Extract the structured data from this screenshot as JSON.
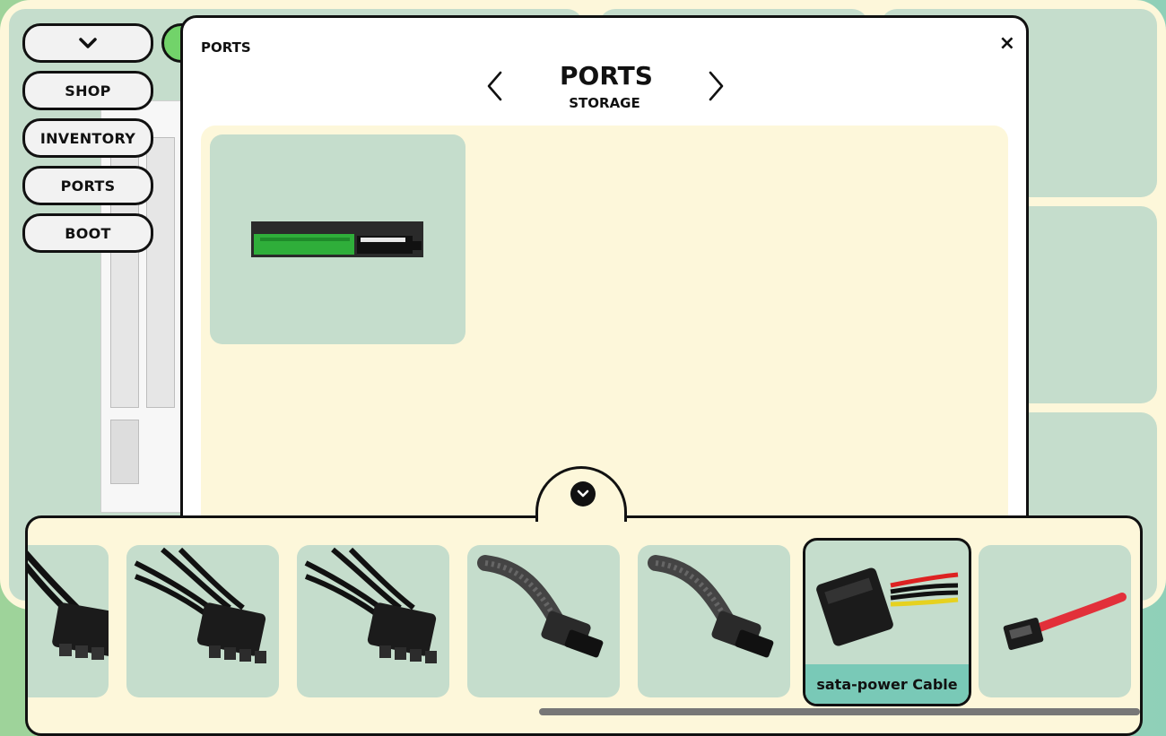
{
  "sidebar": {
    "toggle_icon": "chevron-down-icon",
    "items": [
      {
        "label": "SHOP"
      },
      {
        "label": "INVENTORY"
      },
      {
        "label": "PORTS"
      },
      {
        "label": "BOOT"
      }
    ]
  },
  "modal": {
    "small_title": "PORTS",
    "close_label": "×",
    "title": "PORTS",
    "subtitle": "STORAGE",
    "prev_icon": "chevron-left-icon",
    "next_icon": "chevron-right-icon",
    "ports": [
      {
        "icon": "sata-port-icon"
      }
    ]
  },
  "tray": {
    "collapse_icon": "chevron-down-icon",
    "items": [
      {
        "icon": "pcie-power-cable-icon",
        "selected": false
      },
      {
        "icon": "pcie-power-cable-icon",
        "selected": false
      },
      {
        "icon": "pcie-power-cable-icon",
        "selected": false
      },
      {
        "icon": "sleeved-power-cable-icon",
        "selected": false
      },
      {
        "icon": "sleeved-power-cable-icon",
        "selected": false
      },
      {
        "icon": "sata-power-cable-icon",
        "selected": true,
        "label": "sata-power Cable"
      },
      {
        "icon": "sata-data-cable-icon",
        "selected": false
      }
    ]
  },
  "colors": {
    "cream": "#fdf7da",
    "mint": "#c5ddcc",
    "accent": "#79c9b7",
    "green": "#72d36a"
  }
}
